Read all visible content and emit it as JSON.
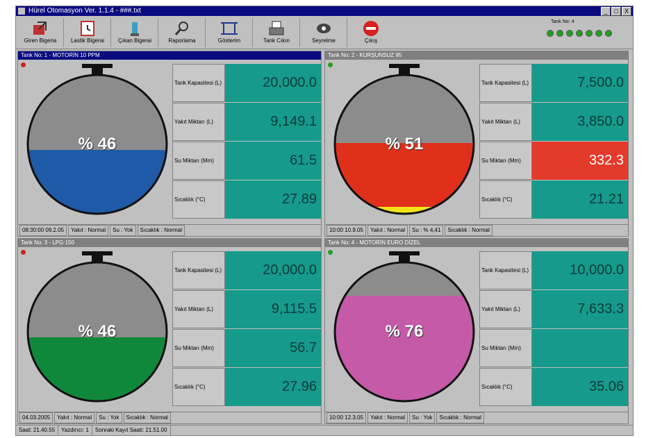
{
  "window": {
    "title": "Hürel Otomasyon Ver. 1.1.4 - ###.txt",
    "controls": [
      "_",
      "□",
      "X"
    ]
  },
  "toolbar": {
    "buttons": [
      {
        "label": "Giren Bigeria",
        "icon": "arrow-in-icon"
      },
      {
        "label": "Lastik Bigerai",
        "icon": "clock-icon"
      },
      {
        "label": "Çıkan Bigerai",
        "icon": "fuel-nozzle-icon"
      },
      {
        "label": "Raporlama",
        "icon": "magnifier-icon"
      },
      {
        "label": "Gösterim",
        "icon": "window-frame-icon"
      },
      {
        "label": "Tank Cıkın",
        "icon": "printer-icon"
      },
      {
        "label": "Seyrelme",
        "icon": "eye-icon"
      },
      {
        "label": "Çıkış",
        "icon": "stop-sign-icon"
      }
    ],
    "legend_label": "Tank No: 4"
  },
  "labels": {
    "capacity": "Tank Kapasitesi (L)",
    "volume": "Yakıt Miktarı (L)",
    "water": "Su Miktarı (Mm)",
    "temp": "Sıcaklık (°C)"
  },
  "tanks": [
    {
      "header": "Tank No: 1 - MOTORİN 10 PPM",
      "header_state": "active",
      "led": "#d02020",
      "percent": "% 46",
      "fill_fraction": 0.46,
      "fuel_color": "#1f5aa8",
      "water_fraction": 0,
      "capacity": "20,000.0",
      "volume": "9,149.1",
      "water": "61.5",
      "temp": "27.89",
      "water_alarm": false,
      "status": [
        "08:30:00 09.2.05",
        "Yakıt : Normal",
        "Su : Yok",
        "Sıcaklık : Normal"
      ]
    },
    {
      "header": "Tank No: 2 - KURŞUNSUZ 95",
      "header_state": "inactive",
      "led": "#20a020",
      "percent": "% 51",
      "fill_fraction": 0.51,
      "fuel_color": "#e0301c",
      "water_fraction": 0.05,
      "capacity": "7,500.0",
      "volume": "3,850.0",
      "water": "332.3",
      "temp": "21.21",
      "water_alarm": true,
      "status": [
        "10:00 10.9.05",
        "Yakıt : Normal",
        "Su : % 4,41",
        "Sıcaklık : Normal"
      ]
    },
    {
      "header": "Tank No: 3 - LPG 150",
      "header_state": "inactive",
      "led": "#d02020",
      "percent": "% 46",
      "fill_fraction": 0.46,
      "fuel_color": "#10883c",
      "water_fraction": 0,
      "capacity": "20,000.0",
      "volume": "9,115.5",
      "water": "56.7",
      "temp": "27.96",
      "water_alarm": false,
      "status": [
        "04.03.2005",
        "Yakıt : Normal",
        "Su : Yok",
        "Sıcaklık : Normal"
      ]
    },
    {
      "header": "Tank No: 4 - MOTORİN EURO DİZEL",
      "header_state": "inactive",
      "led": "#20a020",
      "percent": "% 76",
      "fill_fraction": 0.76,
      "fuel_color": "#c45aa8",
      "water_fraction": 0,
      "capacity": "10,000.0",
      "volume": "7,633.3",
      "water": "",
      "temp": "35.06",
      "water_alarm": false,
      "status": [
        "10:00 12.3.05",
        "Yakıt : Normal",
        "Su : Yok",
        "Sıcaklık : Normal"
      ]
    }
  ],
  "statusbar": [
    "Saat: 21.40.55",
    "Yazdırıcı: 1",
    "Sonraki Kayıt Saati: 21.51.00"
  ],
  "colors": {
    "value_bg": "#169a8c",
    "alarm_bg": "#e33a2b",
    "tank_gray": "#8c8c8c"
  }
}
